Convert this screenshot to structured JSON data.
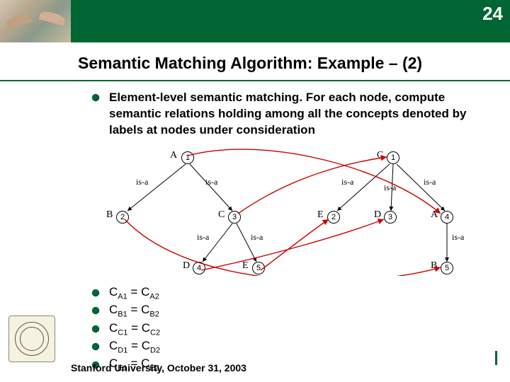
{
  "page_number": "24",
  "title": "Semantic Matching Algorithm: Example – (2)",
  "bullet_main": "Element-level semantic matching. For each node, compute semantic relations holding among all the concepts denoted by labels at nodes under consideration",
  "diagram": {
    "left_tree": {
      "root": {
        "id": "1",
        "label": "A"
      },
      "children": [
        {
          "id": "2",
          "label": "B",
          "edge": "is-a"
        },
        {
          "id": "3",
          "label": "C",
          "edge": "is-a",
          "children": [
            {
              "id": "4",
              "label": "D",
              "edge": "is-a"
            },
            {
              "id": "5",
              "label": "E",
              "edge": "is-a"
            }
          ]
        }
      ]
    },
    "right_tree": {
      "root": {
        "id": "1",
        "label": "C"
      },
      "children": [
        {
          "id": "2",
          "label": "E",
          "edge": "is-a"
        },
        {
          "id": "3",
          "label": "D",
          "edge": "is-a"
        },
        {
          "id": "4",
          "label": "A",
          "edge": "is-a",
          "children": [
            {
              "id": "5",
              "label": "B",
              "edge": "is-a"
            }
          ]
        }
      ]
    },
    "mappings": [
      {
        "from": "left.1",
        "to": "right.4"
      },
      {
        "from": "left.2",
        "to": "right.5"
      },
      {
        "from": "left.3",
        "to": "right.1"
      },
      {
        "from": "left.4",
        "to": "right.3"
      },
      {
        "from": "left.5",
        "to": "right.2"
      }
    ],
    "edge_label": "is-a"
  },
  "equations": [
    {
      "lhs_base": "C",
      "lhs_sub": "A",
      "lhs_idx": "1",
      "rhs_base": "C",
      "rhs_sub": "A",
      "rhs_idx": "2"
    },
    {
      "lhs_base": "C",
      "lhs_sub": "B",
      "lhs_idx": "1",
      "rhs_base": "C",
      "rhs_sub": "B",
      "rhs_idx": "2"
    },
    {
      "lhs_base": "C",
      "lhs_sub": "C",
      "lhs_idx": "1",
      "rhs_base": "C",
      "rhs_sub": "C",
      "rhs_idx": "2"
    },
    {
      "lhs_base": "C",
      "lhs_sub": "D",
      "lhs_idx": "1",
      "rhs_base": "C",
      "rhs_sub": "D",
      "rhs_idx": "2"
    },
    {
      "lhs_base": "C",
      "lhs_sub": "E",
      "lhs_idx": "1",
      "rhs_base": "C",
      "rhs_sub": "E",
      "rhs_idx": "2"
    }
  ],
  "footer": "Stanford University, October 31, 2003",
  "colors": {
    "accent": "#006633",
    "mapping": "#cc0000"
  }
}
